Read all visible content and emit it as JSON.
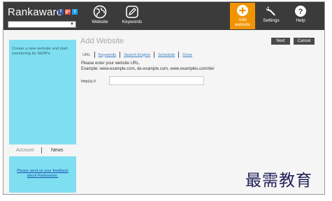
{
  "app": {
    "title": "Rankaware",
    "social": [
      "f",
      "g+",
      "t"
    ]
  },
  "nav": {
    "website": "Website",
    "keywords": "Keywords",
    "add_website": "Add\nwebsite",
    "settings": "Settings",
    "help": "Help"
  },
  "sidebar": {
    "text": "Create a new website and start monitoring its SERPs",
    "tabs": {
      "account": "Account",
      "news": "News"
    },
    "feedback_link": "Please send us your feedback about Rankaware."
  },
  "main": {
    "title": "Add Website",
    "steps": [
      "URL",
      "Keywords",
      "Search Engine",
      "Schedule",
      "Done"
    ],
    "next": "Next",
    "cancel": "Cancel",
    "instruction": "Please enter your website URL.",
    "example": "Example: www.example.com, de.example.com, www.examples.com/de/",
    "url_prefix": "http(s)://",
    "url_value": ""
  },
  "watermark": "最需教育",
  "colors": {
    "topbar": "#3b3b3b",
    "accent": "#f29400",
    "sidebar": "#7edff0",
    "link": "#3b7fc4"
  }
}
